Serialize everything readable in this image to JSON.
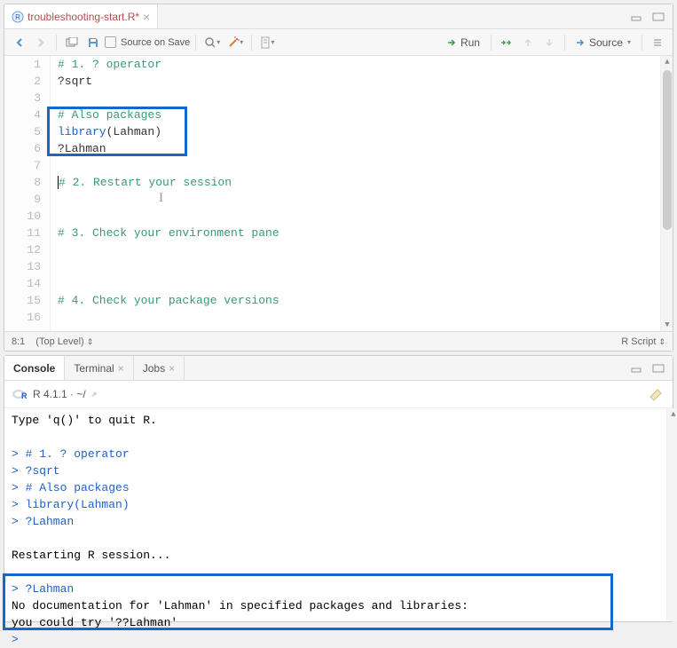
{
  "editor": {
    "tab_filename": "troubleshooting-start.R*",
    "source_on_save": "Source on Save",
    "run_label": "Run",
    "source_label": "Source",
    "lines": [
      {
        "n": 1,
        "segments": [
          {
            "cls": "comment",
            "t": "# 1. ? operator"
          }
        ]
      },
      {
        "n": 2,
        "segments": [
          {
            "cls": "str",
            "t": "?sqrt"
          }
        ]
      },
      {
        "n": 3,
        "segments": []
      },
      {
        "n": 4,
        "segments": [
          {
            "cls": "comment",
            "t": "# Also packages"
          }
        ]
      },
      {
        "n": 5,
        "segments": [
          {
            "cls": "kw",
            "t": "library"
          },
          {
            "cls": "str",
            "t": "(Lahman)"
          }
        ]
      },
      {
        "n": 6,
        "segments": [
          {
            "cls": "str",
            "t": "?Lahman"
          }
        ]
      },
      {
        "n": 7,
        "segments": []
      },
      {
        "n": 8,
        "segments": [
          {
            "cls": "comment",
            "t": "# 2. Restart your session"
          }
        ]
      },
      {
        "n": 9,
        "segments": []
      },
      {
        "n": 10,
        "segments": []
      },
      {
        "n": 11,
        "segments": [
          {
            "cls": "comment",
            "t": "# 3. Check your environment pane"
          }
        ]
      },
      {
        "n": 12,
        "segments": []
      },
      {
        "n": 13,
        "segments": []
      },
      {
        "n": 14,
        "segments": []
      },
      {
        "n": 15,
        "segments": [
          {
            "cls": "comment",
            "t": "# 4. Check your package versions"
          }
        ]
      },
      {
        "n": 16,
        "segments": []
      }
    ],
    "cursor_pos": "8:1",
    "scope": "(Top Level)",
    "lang": "R Script"
  },
  "console": {
    "tabs": [
      "Console",
      "Terminal",
      "Jobs"
    ],
    "version": "R 4.1.1 · ~/",
    "lines": [
      {
        "prompt": false,
        "t": "Type 'q()' to quit R."
      },
      {
        "prompt": false,
        "t": ""
      },
      {
        "prompt": true,
        "t": "# 1. ? operator"
      },
      {
        "prompt": true,
        "t": "?sqrt"
      },
      {
        "prompt": true,
        "t": "# Also packages"
      },
      {
        "prompt": true,
        "t": "library(Lahman)"
      },
      {
        "prompt": true,
        "t": "?Lahman"
      },
      {
        "prompt": false,
        "t": ""
      },
      {
        "prompt": false,
        "t": "Restarting R session..."
      },
      {
        "prompt": false,
        "t": ""
      },
      {
        "prompt": true,
        "t": "?Lahman"
      },
      {
        "prompt": false,
        "t": "No documentation for 'Lahman' in specified packages and libraries:"
      },
      {
        "prompt": false,
        "t": "you could try '??Lahman'"
      },
      {
        "prompt": true,
        "t": ""
      }
    ]
  }
}
